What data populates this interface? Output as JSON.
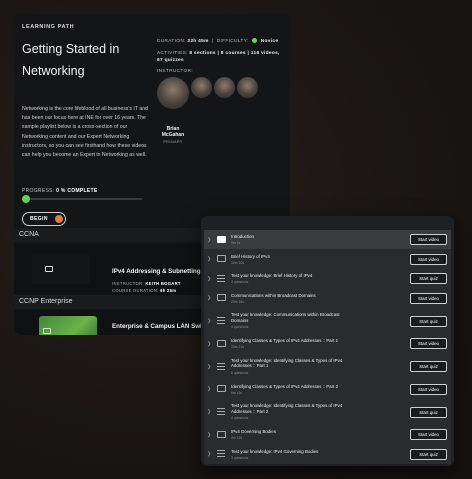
{
  "learning_path": {
    "label": "LEARNING PATH",
    "title": "Getting Started in Networking",
    "duration_label": "DURATION:",
    "duration_value": "22h 45m",
    "difficulty_label": "DIFFICULTY:",
    "difficulty_value": "Novice",
    "activities_label": "ACTIVITIES:",
    "activities_value": "8 sections | 8 courses | 116 videos, 67 quizzes",
    "instructor_label": "INSTRUCTOR:",
    "instructor_name": "Brian McGahan",
    "instructor_role": "PRIMARY",
    "description": "Networking is the core lifeblood of all business's IT and has been our focus here at INE for over 16 years. The sample playlist below is a cross-section of our Networking content and our Expert Networking instructors, so you can see firsthand how these videos can help you become an Expert in Networking as well.",
    "progress_label": "PROGRESS:",
    "progress_value": "0 % COMPLETE",
    "progress_fraction": 0,
    "begin_label": "BEGIN"
  },
  "sections": [
    {
      "name": "CCNA",
      "course_title": "IPv4 Addressing & Subnetting",
      "instructor_label": "INSTRUCTOR:",
      "instructor_value": "KEITH BOGART",
      "duration_label": "COURSE DURATION:",
      "duration_value": "6h 25m"
    },
    {
      "name": "CCNP Enterprise",
      "course_title": "Enterprise & Campus LAN Swi"
    }
  ],
  "content_window": {
    "items": [
      {
        "type": "video",
        "title": "Introduction",
        "sub": "9m 1s",
        "button": "Start video",
        "active": true
      },
      {
        "type": "video",
        "title": "Brief History of IPv4",
        "sub": "16m 10s",
        "button": "Start video"
      },
      {
        "type": "quiz",
        "title": "Test your knowledge: Brief History of IPv4",
        "sub": "3 questions",
        "button": "Start quiz"
      },
      {
        "type": "video",
        "title": "Communications within Broadcast Domains",
        "sub": "20m 15s",
        "button": "Start video"
      },
      {
        "type": "quiz",
        "title": "Test your knowledge: Communications within Broadcast Domains",
        "sub": "4 questions",
        "button": "Start quiz"
      },
      {
        "type": "video",
        "title": "Identifying Classes & Types of IPv4 Addresses :: Part 1",
        "sub": "24m 21s",
        "button": "Start video"
      },
      {
        "type": "quiz",
        "title": "Test your knowledge: Identifying Classes & Types of IPv4 Addresses :: Part 1",
        "sub": "6 questions",
        "button": "Start quiz"
      },
      {
        "type": "video",
        "title": "Identifying Classes & Types of IPv4 Addresses :: Part 2",
        "sub": "8m 43s",
        "button": "Start video"
      },
      {
        "type": "quiz",
        "title": "Test your knowledge: Identifying Classes & Types of IPv4 Addresses :: Part 2",
        "sub": "4 questions",
        "button": "Start quiz"
      },
      {
        "type": "video",
        "title": "IPv4 Governing Bodies",
        "sub": "4m 12s",
        "button": "Start video"
      },
      {
        "type": "quiz",
        "title": "Test your knowledge: IPv4 Governing Bodies",
        "sub": "3 questions",
        "button": "Start quiz"
      }
    ]
  },
  "colors": {
    "accent_green": "#5fd35f",
    "accent_orange": "#e47c3a",
    "window_dot_red": "#e0504a",
    "window_dot_grey": "#8a8a8a"
  }
}
